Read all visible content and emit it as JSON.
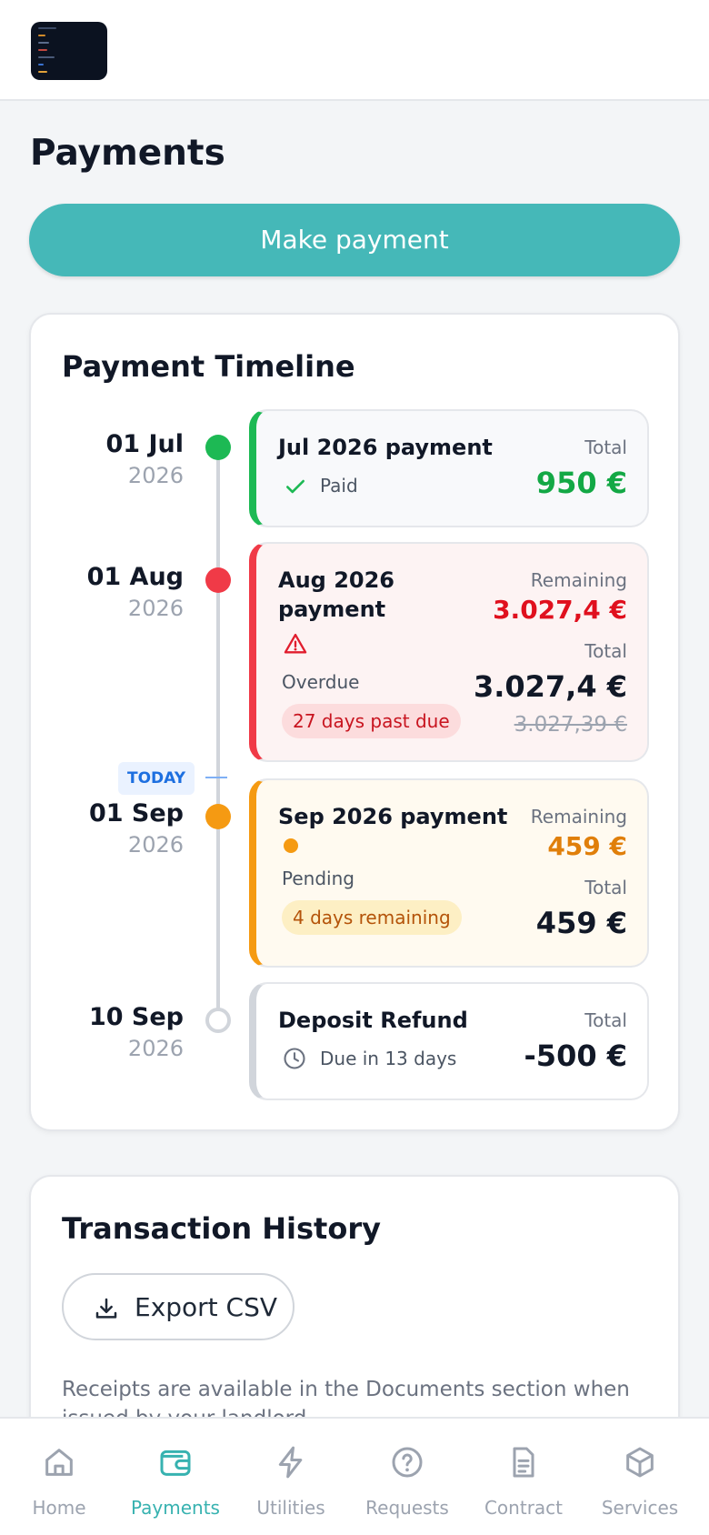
{
  "header": {
    "logo_alt": "app-logo"
  },
  "page": {
    "title": "Payments",
    "make_payment_label": "Make payment"
  },
  "timeline": {
    "title": "Payment Timeline",
    "today_label": "TODAY",
    "items": [
      {
        "date": "01 Jul",
        "year": "2026",
        "name": "Jul 2026 payment",
        "status": "Paid",
        "total_label": "Total",
        "total": "950 €",
        "accent": "#1db954"
      },
      {
        "date": "01 Aug",
        "year": "2026",
        "name": "Aug 2026 payment",
        "status": "Overdue",
        "remaining_label": "Remaining",
        "remaining": "3.027,4 €",
        "total_label": "Total",
        "total": "3.027,4 €",
        "original_total": "3.027,39 €",
        "pill": "27 days past due",
        "accent": "#f03a47"
      },
      {
        "date": "01 Sep",
        "year": "2026",
        "name": "Sep 2026 payment",
        "status": "Pending",
        "remaining_label": "Remaining",
        "remaining": "459 €",
        "total_label": "Total",
        "total": "459 €",
        "pill": "4 days remaining",
        "accent": "#f59a12"
      },
      {
        "date": "10 Sep",
        "year": "2026",
        "name": "Deposit Refund",
        "status": "Due in 13 days",
        "total_label": "Total",
        "total": "-500 €",
        "accent": "#d1d5db"
      }
    ]
  },
  "history": {
    "title": "Transaction History",
    "export_label": "Export CSV",
    "receipts_note": "Receipts are available in the Documents section when issued by your landlord."
  },
  "nav": {
    "active": "Payments",
    "items": [
      {
        "label": "Home",
        "icon": "home-icon"
      },
      {
        "label": "Payments",
        "icon": "wallet-icon"
      },
      {
        "label": "Utilities",
        "icon": "bolt-icon"
      },
      {
        "label": "Requests",
        "icon": "help-circle-icon"
      },
      {
        "label": "Contract",
        "icon": "document-icon"
      },
      {
        "label": "Services",
        "icon": "box-icon"
      }
    ]
  },
  "colors": {
    "brand": "#45b8b8",
    "paid": "#1db954",
    "overdue": "#f03a47",
    "pending": "#f59a12",
    "today": "#1d6fe0"
  }
}
